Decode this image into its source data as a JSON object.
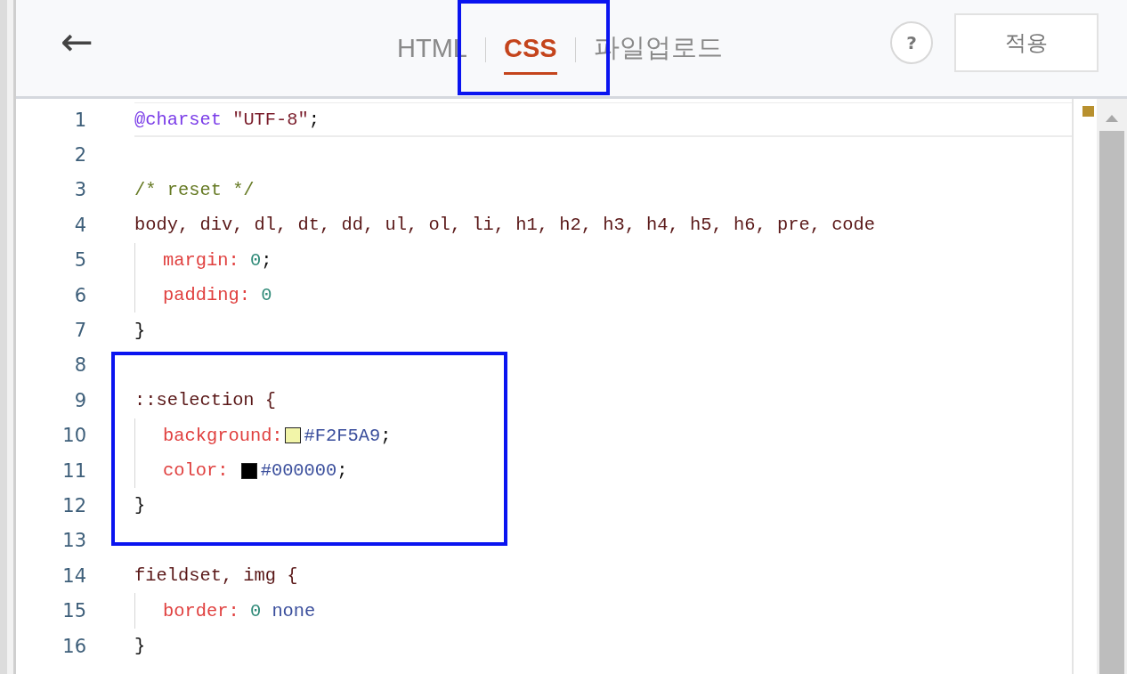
{
  "header": {
    "back_button": "←",
    "tabs": [
      {
        "label": "HTML",
        "selected": false
      },
      {
        "label": "CSS",
        "selected": true
      },
      {
        "label": "파일업로드",
        "selected": false
      }
    ],
    "help_button": "?",
    "apply_button": "적용"
  },
  "editor": {
    "lines": [
      {
        "number": "1",
        "active": true,
        "indented": false,
        "tokens": [
          {
            "kind": "atrule",
            "text": "@charset"
          },
          {
            "kind": "string",
            "text": " \"UTF-8\""
          },
          {
            "kind": "punct",
            "text": ";"
          }
        ]
      },
      {
        "number": "2",
        "active": false,
        "indented": false
      },
      {
        "number": "3",
        "active": false,
        "indented": false,
        "tokens": [
          {
            "kind": "comment",
            "text": "/* reset */"
          }
        ]
      },
      {
        "number": "4",
        "active": false,
        "indented": false,
        "tokens": [
          {
            "kind": "selector",
            "text": "body, div, dl, dt, dd, ul, ol, li, h1, h2, h3, h4, h5, h6, pre, code"
          }
        ]
      },
      {
        "number": "5",
        "active": false,
        "indented": true,
        "tokens": [
          {
            "kind": "property",
            "text": "margin:"
          },
          {
            "kind": "number",
            "text": " 0"
          },
          {
            "kind": "punct",
            "text": ";"
          }
        ]
      },
      {
        "number": "6",
        "active": false,
        "indented": true,
        "tokens": [
          {
            "kind": "property",
            "text": "padding:"
          },
          {
            "kind": "number",
            "text": " 0"
          }
        ]
      },
      {
        "number": "7",
        "active": false,
        "indented": false,
        "tokens": [
          {
            "kind": "punct",
            "text": "}"
          }
        ]
      },
      {
        "number": "8",
        "active": false,
        "indented": false
      },
      {
        "number": "9",
        "active": false,
        "indented": false,
        "tokens": [
          {
            "kind": "selector",
            "text": "::selection {"
          }
        ]
      },
      {
        "number": "10",
        "active": false,
        "indented": true,
        "tokens": [
          {
            "kind": "property",
            "text": "background:"
          },
          {
            "kind": "swatch",
            "color": "#f2f5a9"
          },
          {
            "kind": "value",
            "text": "#F2F5A9"
          },
          {
            "kind": "punct",
            "text": ";"
          }
        ]
      },
      {
        "number": "11",
        "active": false,
        "indented": true,
        "tokens": [
          {
            "kind": "property",
            "text": "color: "
          },
          {
            "kind": "swatch",
            "color": "#000000"
          },
          {
            "kind": "value",
            "text": "#000000"
          },
          {
            "kind": "punct",
            "text": ";"
          }
        ]
      },
      {
        "number": "12",
        "active": false,
        "indented": false,
        "tokens": [
          {
            "kind": "punct",
            "text": "}"
          }
        ]
      },
      {
        "number": "13",
        "active": false,
        "indented": false
      },
      {
        "number": "14",
        "active": false,
        "indented": false,
        "tokens": [
          {
            "kind": "selector",
            "text": "fieldset, img {"
          }
        ]
      },
      {
        "number": "15",
        "active": false,
        "indented": true,
        "tokens": [
          {
            "kind": "property",
            "text": "border:"
          },
          {
            "kind": "number",
            "text": " 0"
          },
          {
            "kind": "value",
            "text": " none"
          }
        ]
      },
      {
        "number": "16",
        "active": false,
        "indented": false,
        "tokens": [
          {
            "kind": "punct",
            "text": "}"
          }
        ]
      }
    ]
  }
}
